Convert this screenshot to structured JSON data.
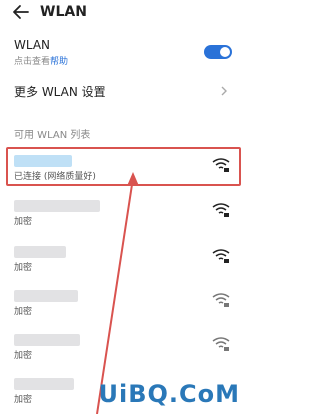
{
  "header": {
    "title": "WLAN"
  },
  "wlan_toggle": {
    "label": "WLAN",
    "hint_prefix": "点击查看",
    "hint_link": "帮助",
    "on": true
  },
  "more_settings": {
    "label": "更多 WLAN 设置"
  },
  "available": {
    "header": "可用 WLAN 列表"
  },
  "networks": [
    {
      "status": "已连接 (网络质量好)"
    },
    {
      "status": "加密"
    },
    {
      "status": "加密"
    },
    {
      "status": "加密"
    },
    {
      "status": "加密"
    },
    {
      "status": "加密"
    }
  ],
  "watermark": "UiBQ.CoM",
  "colors": {
    "accent": "#2a72d8",
    "highlight": "#d9534f",
    "watermark": "#2a78b8"
  }
}
